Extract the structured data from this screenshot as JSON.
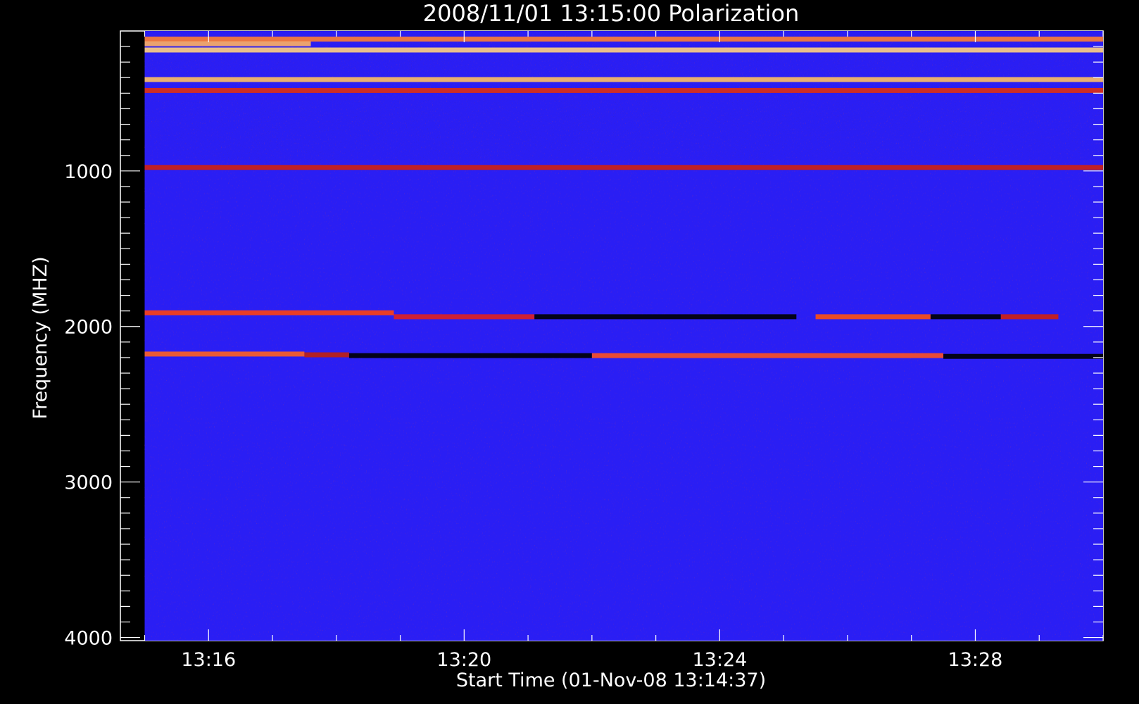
{
  "chart_data": {
    "type": "heatmap",
    "title": "2008/11/01  13:15:00 Polarization",
    "xlabel": "Start Time (01-Nov-08 13:14:37)",
    "ylabel": "Frequency (MHZ)",
    "x_range_minutes_after_1300": [
      14.62,
      30.0
    ],
    "y_range_mhz": [
      100,
      4020
    ],
    "y_inverted": true,
    "x_ticks": [
      {
        "label": "13:16",
        "minute": 16
      },
      {
        "label": "13:20",
        "minute": 20
      },
      {
        "label": "13:24",
        "minute": 24
      },
      {
        "label": "13:28",
        "minute": 28
      }
    ],
    "y_ticks": [
      {
        "label": "1000",
        "value": 1000
      },
      {
        "label": "2000",
        "value": 2000
      },
      {
        "label": "3000",
        "value": 3000
      },
      {
        "label": "4000",
        "value": 4000
      }
    ],
    "data_extent": {
      "time_start_minute": 15.0,
      "time_end_minute": 30.0,
      "freq_start_mhz": 100,
      "freq_end_mhz": 4020
    },
    "background_color": "#2a1ef4",
    "bands": [
      {
        "freq_mhz": 150,
        "t_start": 15.0,
        "t_end": 30.0,
        "color": "#ff8030"
      },
      {
        "freq_mhz": 180,
        "t_start": 15.0,
        "t_end": 17.6,
        "color": "#ffb060"
      },
      {
        "freq_mhz": 220,
        "t_start": 15.0,
        "t_end": 30.0,
        "color": "#ffd080"
      },
      {
        "freq_mhz": 410,
        "t_start": 15.0,
        "t_end": 30.0,
        "color": "#ffc060"
      },
      {
        "freq_mhz": 480,
        "t_start": 15.0,
        "t_end": 30.0,
        "color": "#e03010"
      },
      {
        "freq_mhz": 975,
        "t_start": 15.0,
        "t_end": 30.0,
        "color": "#d02010"
      },
      {
        "freq_mhz": 1910,
        "t_start": 15.0,
        "t_end": 18.9,
        "color": "#ff4010"
      },
      {
        "freq_mhz": 1935,
        "t_start": 18.9,
        "t_end": 21.1,
        "color": "#e02020"
      },
      {
        "freq_mhz": 1935,
        "t_start": 21.1,
        "t_end": 25.2,
        "color": "#000000"
      },
      {
        "freq_mhz": 1935,
        "t_start": 25.5,
        "t_end": 27.3,
        "color": "#ff5010"
      },
      {
        "freq_mhz": 1935,
        "t_start": 27.3,
        "t_end": 28.4,
        "color": "#000000"
      },
      {
        "freq_mhz": 1935,
        "t_start": 28.4,
        "t_end": 29.3,
        "color": "#d02010"
      },
      {
        "freq_mhz": 2175,
        "t_start": 15.0,
        "t_end": 17.5,
        "color": "#ff6020"
      },
      {
        "freq_mhz": 2180,
        "t_start": 17.5,
        "t_end": 18.2,
        "color": "#c02010"
      },
      {
        "freq_mhz": 2185,
        "t_start": 18.2,
        "t_end": 22.0,
        "color": "#000000"
      },
      {
        "freq_mhz": 2185,
        "t_start": 22.0,
        "t_end": 27.5,
        "color": "#ff5020"
      },
      {
        "freq_mhz": 2190,
        "t_start": 27.5,
        "t_end": 30.0,
        "color": "#000000"
      }
    ]
  }
}
